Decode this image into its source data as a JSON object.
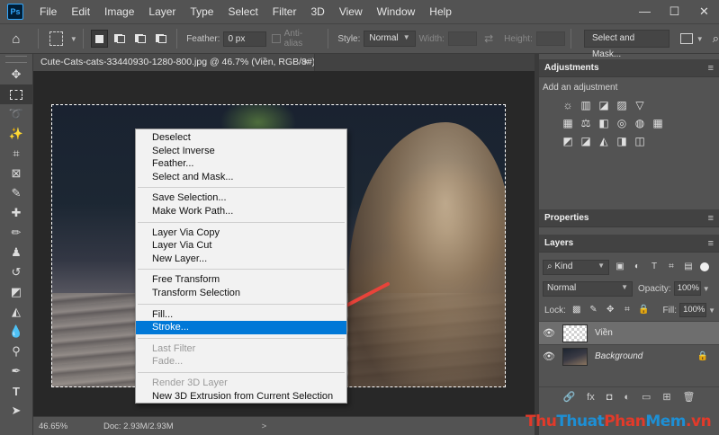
{
  "menubar": {
    "logo": "Ps",
    "items": [
      "File",
      "Edit",
      "Image",
      "Layer",
      "Type",
      "Select",
      "Filter",
      "3D",
      "View",
      "Window",
      "Help"
    ],
    "window_controls": [
      "—",
      "☐",
      "✕"
    ]
  },
  "options": {
    "feather_label": "Feather:",
    "feather_value": "0 px",
    "antialias_label": "Anti-alias",
    "style_label": "Style:",
    "style_value": "Normal",
    "width_label": "Width:",
    "height_label": "Height:",
    "select_and_mask": "Select and Mask..."
  },
  "document": {
    "tab_title": "Cute-Cats-cats-33440930-1280-800.jpg @ 46.7% (Viền, RGB/8#) *",
    "tab_close": "×"
  },
  "context_menu": {
    "groups": [
      [
        {
          "label": "Deselect"
        },
        {
          "label": "Select Inverse"
        },
        {
          "label": "Feather..."
        },
        {
          "label": "Select and Mask..."
        }
      ],
      [
        {
          "label": "Save Selection..."
        },
        {
          "label": "Make Work Path..."
        }
      ],
      [
        {
          "label": "Layer Via Copy"
        },
        {
          "label": "Layer Via Cut"
        },
        {
          "label": "New Layer..."
        }
      ],
      [
        {
          "label": "Free Transform"
        },
        {
          "label": "Transform Selection"
        }
      ],
      [
        {
          "label": "Fill..."
        },
        {
          "label": "Stroke..."
        }
      ],
      [
        {
          "label": "Last Filter"
        },
        {
          "label": "Fade..."
        }
      ],
      [
        {
          "label": "Render 3D Layer"
        },
        {
          "label": "New 3D Extrusion from Current Selection"
        }
      ]
    ],
    "highlighted": "Stroke...",
    "disabled": [
      "Last Filter",
      "Fade...",
      "Render 3D Layer"
    ]
  },
  "statusbar": {
    "zoom": "46.65%",
    "doc_info": "Doc: 2.93M/2.93M",
    "chevron": ">"
  },
  "adjustments": {
    "title": "Adjustments",
    "subtitle": "Add an adjustment",
    "row1": [
      "☼",
      "▥",
      "◪",
      "▨",
      "▽"
    ],
    "row2": [
      "▦",
      "⚖",
      "◧",
      "◎",
      "◍",
      "▦"
    ],
    "row3": [
      "◩",
      "◪",
      "◭",
      "◨",
      "◫"
    ]
  },
  "properties": {
    "title": "Properties"
  },
  "layers": {
    "title": "Layers",
    "kind": "Kind",
    "blend_mode": "Normal",
    "opacity_label": "Opacity:",
    "opacity_value": "100%",
    "lock_label": "Lock:",
    "fill_label": "Fill:",
    "fill_value": "100%",
    "items": [
      {
        "name": "Viền",
        "selected": true
      },
      {
        "name": "Background",
        "selected": false
      }
    ],
    "footer_icons": [
      "🔗",
      "fx",
      "◘",
      "◐",
      "▭",
      "⊞",
      "🗑"
    ]
  },
  "watermark": {
    "part1": "Thu",
    "part2": "Thuat",
    "part3": "Phan",
    "part4": "Mem",
    "part5": ".vn"
  },
  "colors": {
    "highlight": "#0078d7",
    "arrow": "#e8433a",
    "panel_bg": "#535353",
    "canvas_bg": "#282828"
  }
}
